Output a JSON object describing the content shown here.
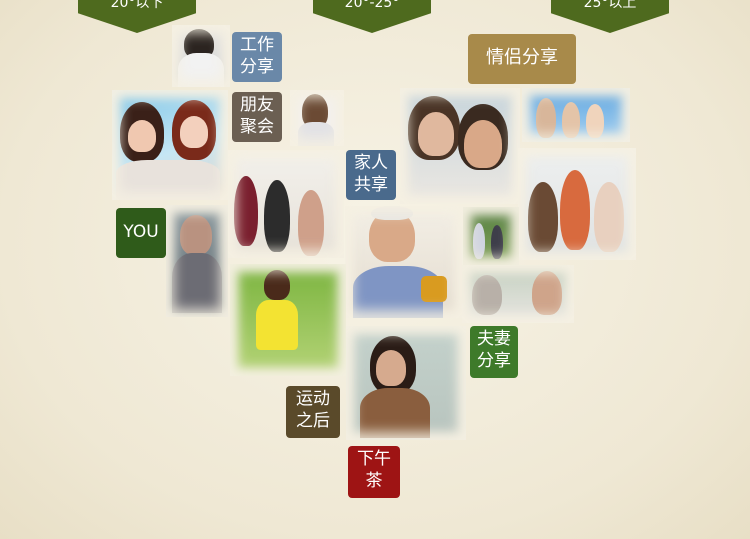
{
  "banners": [
    {
      "label": "20°以下",
      "color": "#4e6a1e"
    },
    {
      "label": "20°-25°",
      "color": "#4e6a1e"
    },
    {
      "label": "25°以上",
      "color": "#4e6a1e"
    }
  ],
  "tags": {
    "work_share": {
      "line1": "工作",
      "line2": "分享",
      "color": "#6a88a8"
    },
    "friends": {
      "line1": "朋友",
      "line2": "聚会",
      "color": "#6b5f52"
    },
    "family": {
      "line1": "家人",
      "line2": "共享",
      "color": "#4a6a8c"
    },
    "couple": {
      "label": "情侣分享",
      "color": "#a88a4a"
    },
    "you": {
      "label": "YOU",
      "color": "#2f5b1a"
    },
    "spouse": {
      "line1": "夫妻",
      "line2": "分享",
      "color": "#3e7a2a"
    },
    "sport": {
      "line1": "运动",
      "line2": "之后",
      "color": "#5a4a2a"
    },
    "tea": {
      "line1": "下午",
      "line2": "茶",
      "color": "#9e1414"
    }
  }
}
